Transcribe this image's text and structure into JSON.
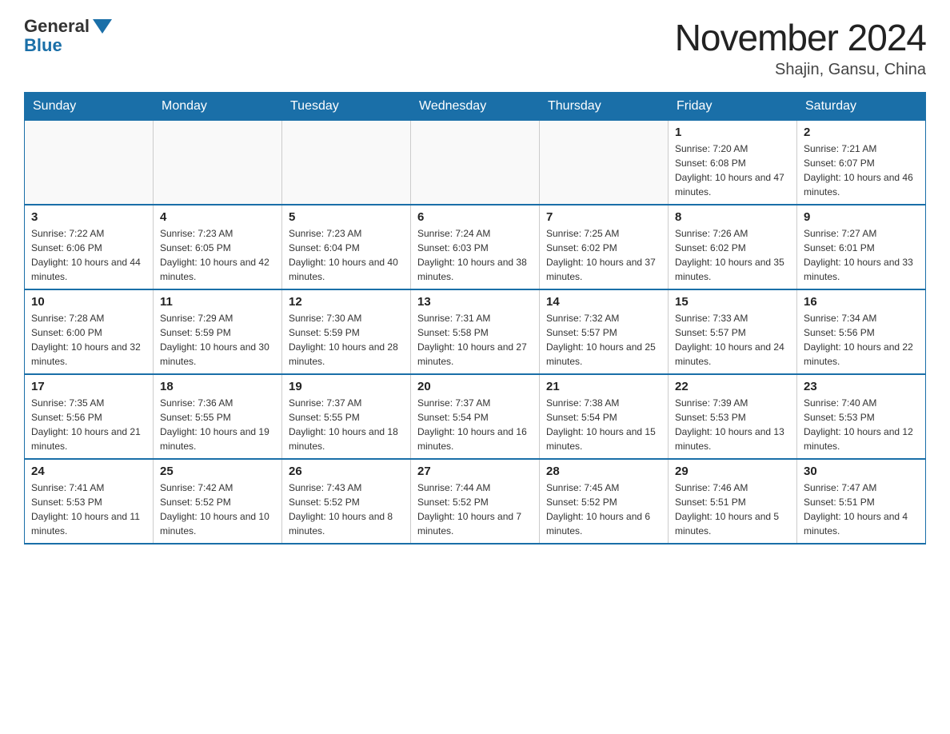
{
  "logo": {
    "general": "General",
    "blue": "Blue"
  },
  "title": {
    "month_year": "November 2024",
    "location": "Shajin, Gansu, China"
  },
  "days_of_week": [
    "Sunday",
    "Monday",
    "Tuesday",
    "Wednesday",
    "Thursday",
    "Friday",
    "Saturday"
  ],
  "weeks": [
    [
      {
        "day": "",
        "info": ""
      },
      {
        "day": "",
        "info": ""
      },
      {
        "day": "",
        "info": ""
      },
      {
        "day": "",
        "info": ""
      },
      {
        "day": "",
        "info": ""
      },
      {
        "day": "1",
        "info": "Sunrise: 7:20 AM\nSunset: 6:08 PM\nDaylight: 10 hours and 47 minutes."
      },
      {
        "day": "2",
        "info": "Sunrise: 7:21 AM\nSunset: 6:07 PM\nDaylight: 10 hours and 46 minutes."
      }
    ],
    [
      {
        "day": "3",
        "info": "Sunrise: 7:22 AM\nSunset: 6:06 PM\nDaylight: 10 hours and 44 minutes."
      },
      {
        "day": "4",
        "info": "Sunrise: 7:23 AM\nSunset: 6:05 PM\nDaylight: 10 hours and 42 minutes."
      },
      {
        "day": "5",
        "info": "Sunrise: 7:23 AM\nSunset: 6:04 PM\nDaylight: 10 hours and 40 minutes."
      },
      {
        "day": "6",
        "info": "Sunrise: 7:24 AM\nSunset: 6:03 PM\nDaylight: 10 hours and 38 minutes."
      },
      {
        "day": "7",
        "info": "Sunrise: 7:25 AM\nSunset: 6:02 PM\nDaylight: 10 hours and 37 minutes."
      },
      {
        "day": "8",
        "info": "Sunrise: 7:26 AM\nSunset: 6:02 PM\nDaylight: 10 hours and 35 minutes."
      },
      {
        "day": "9",
        "info": "Sunrise: 7:27 AM\nSunset: 6:01 PM\nDaylight: 10 hours and 33 minutes."
      }
    ],
    [
      {
        "day": "10",
        "info": "Sunrise: 7:28 AM\nSunset: 6:00 PM\nDaylight: 10 hours and 32 minutes."
      },
      {
        "day": "11",
        "info": "Sunrise: 7:29 AM\nSunset: 5:59 PM\nDaylight: 10 hours and 30 minutes."
      },
      {
        "day": "12",
        "info": "Sunrise: 7:30 AM\nSunset: 5:59 PM\nDaylight: 10 hours and 28 minutes."
      },
      {
        "day": "13",
        "info": "Sunrise: 7:31 AM\nSunset: 5:58 PM\nDaylight: 10 hours and 27 minutes."
      },
      {
        "day": "14",
        "info": "Sunrise: 7:32 AM\nSunset: 5:57 PM\nDaylight: 10 hours and 25 minutes."
      },
      {
        "day": "15",
        "info": "Sunrise: 7:33 AM\nSunset: 5:57 PM\nDaylight: 10 hours and 24 minutes."
      },
      {
        "day": "16",
        "info": "Sunrise: 7:34 AM\nSunset: 5:56 PM\nDaylight: 10 hours and 22 minutes."
      }
    ],
    [
      {
        "day": "17",
        "info": "Sunrise: 7:35 AM\nSunset: 5:56 PM\nDaylight: 10 hours and 21 minutes."
      },
      {
        "day": "18",
        "info": "Sunrise: 7:36 AM\nSunset: 5:55 PM\nDaylight: 10 hours and 19 minutes."
      },
      {
        "day": "19",
        "info": "Sunrise: 7:37 AM\nSunset: 5:55 PM\nDaylight: 10 hours and 18 minutes."
      },
      {
        "day": "20",
        "info": "Sunrise: 7:37 AM\nSunset: 5:54 PM\nDaylight: 10 hours and 16 minutes."
      },
      {
        "day": "21",
        "info": "Sunrise: 7:38 AM\nSunset: 5:54 PM\nDaylight: 10 hours and 15 minutes."
      },
      {
        "day": "22",
        "info": "Sunrise: 7:39 AM\nSunset: 5:53 PM\nDaylight: 10 hours and 13 minutes."
      },
      {
        "day": "23",
        "info": "Sunrise: 7:40 AM\nSunset: 5:53 PM\nDaylight: 10 hours and 12 minutes."
      }
    ],
    [
      {
        "day": "24",
        "info": "Sunrise: 7:41 AM\nSunset: 5:53 PM\nDaylight: 10 hours and 11 minutes."
      },
      {
        "day": "25",
        "info": "Sunrise: 7:42 AM\nSunset: 5:52 PM\nDaylight: 10 hours and 10 minutes."
      },
      {
        "day": "26",
        "info": "Sunrise: 7:43 AM\nSunset: 5:52 PM\nDaylight: 10 hours and 8 minutes."
      },
      {
        "day": "27",
        "info": "Sunrise: 7:44 AM\nSunset: 5:52 PM\nDaylight: 10 hours and 7 minutes."
      },
      {
        "day": "28",
        "info": "Sunrise: 7:45 AM\nSunset: 5:52 PM\nDaylight: 10 hours and 6 minutes."
      },
      {
        "day": "29",
        "info": "Sunrise: 7:46 AM\nSunset: 5:51 PM\nDaylight: 10 hours and 5 minutes."
      },
      {
        "day": "30",
        "info": "Sunrise: 7:47 AM\nSunset: 5:51 PM\nDaylight: 10 hours and 4 minutes."
      }
    ]
  ]
}
